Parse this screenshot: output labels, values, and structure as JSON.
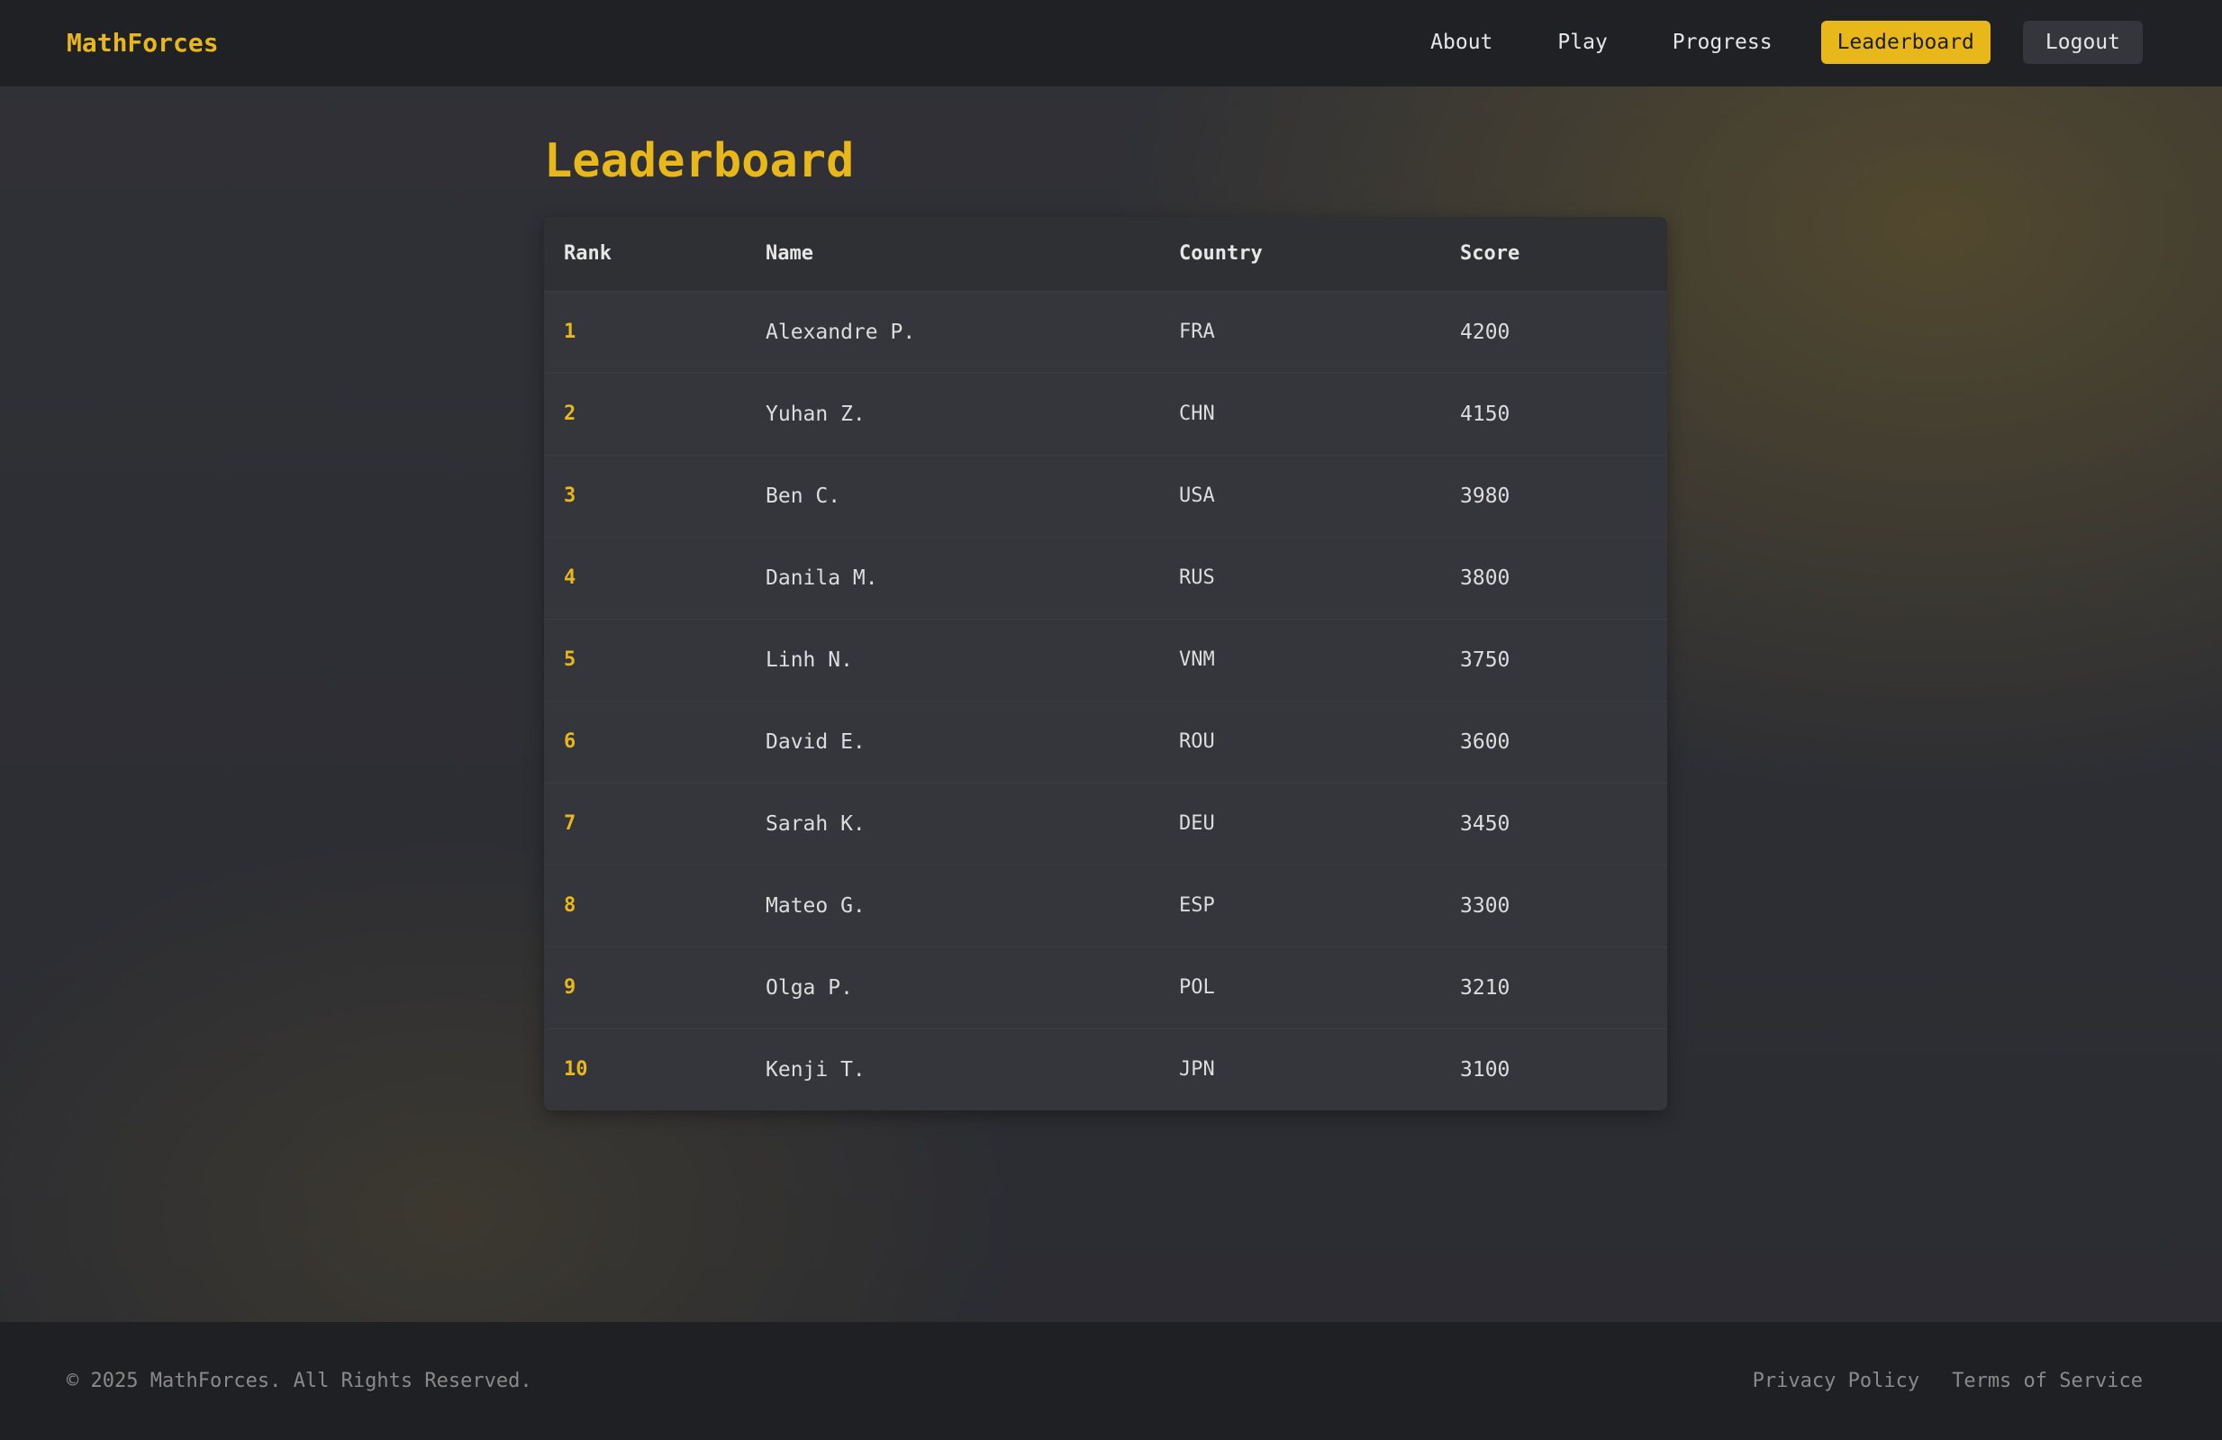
{
  "header": {
    "logo": "MathForces",
    "nav": [
      {
        "label": "About"
      },
      {
        "label": "Play"
      },
      {
        "label": "Progress"
      },
      {
        "label": "Leaderboard",
        "active": true
      },
      {
        "label": "Logout"
      }
    ]
  },
  "main": {
    "title": "Leaderboard",
    "table": {
      "columns": [
        "Rank",
        "Name",
        "Country",
        "Score"
      ],
      "rows": [
        {
          "rank": "1",
          "name": "Alexandre P.",
          "country": "FRA",
          "score": "4200"
        },
        {
          "rank": "2",
          "name": "Yuhan Z.",
          "country": "CHN",
          "score": "4150"
        },
        {
          "rank": "3",
          "name": "Ben C.",
          "country": "USA",
          "score": "3980"
        },
        {
          "rank": "4",
          "name": "Danila M.",
          "country": "RUS",
          "score": "3800"
        },
        {
          "rank": "5",
          "name": "Linh N.",
          "country": "VNM",
          "score": "3750"
        },
        {
          "rank": "6",
          "name": "David E.",
          "country": "ROU",
          "score": "3600"
        },
        {
          "rank": "7",
          "name": "Sarah K.",
          "country": "DEU",
          "score": "3450"
        },
        {
          "rank": "8",
          "name": "Mateo G.",
          "country": "ESP",
          "score": "3300"
        },
        {
          "rank": "9",
          "name": "Olga P.",
          "country": "POL",
          "score": "3210"
        },
        {
          "rank": "10",
          "name": "Kenji T.",
          "country": "JPN",
          "score": "3100"
        }
      ]
    }
  },
  "footer": {
    "copyright": "© 2025 MathForces. All Rights Reserved.",
    "links": [
      "Privacy Policy",
      "Terms of Service"
    ]
  },
  "colors": {
    "accent": "#e8b71a",
    "header_bg": "#202125",
    "card_bg": "#35363b",
    "footer_bg": "#1f2023"
  }
}
